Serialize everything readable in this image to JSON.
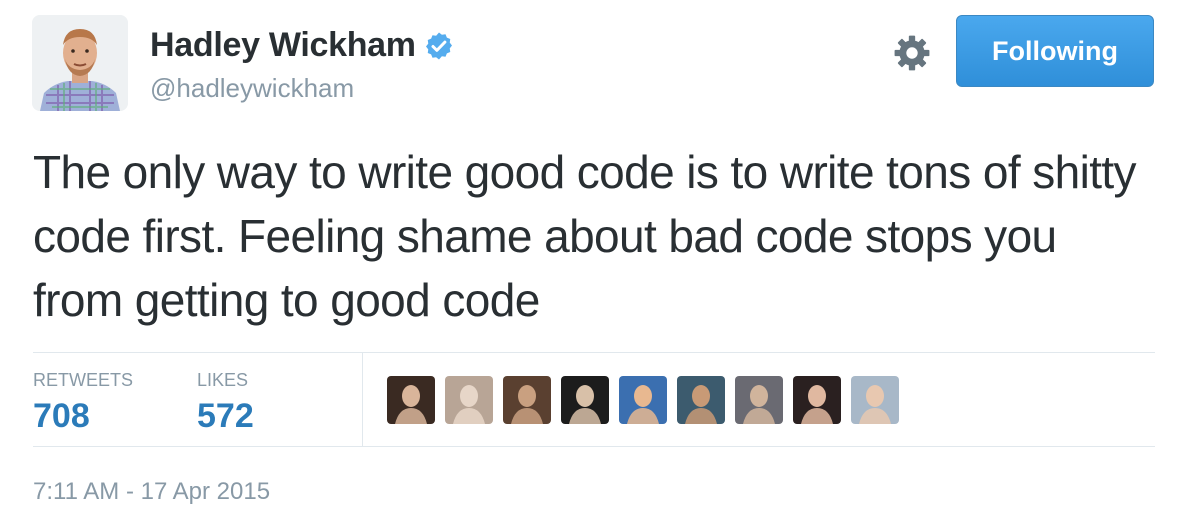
{
  "header": {
    "display_name": "Hadley Wickham",
    "handle": "@hadleywickham",
    "follow_button_label": "Following",
    "icons": {
      "verified": "verified-badge-icon",
      "settings": "gear-icon"
    },
    "colors": {
      "verified": "#55acee",
      "follow_button": "#3b9de8",
      "accent": "#2b7bb9"
    }
  },
  "tweet": {
    "text": "The only way to write good code is to write tons of shitty code first. Feeling shame about bad code stops you from getting to good code"
  },
  "stats": {
    "retweets_label": "RETWEETS",
    "retweets_value": "708",
    "likes_label": "LIKES",
    "likes_value": "572"
  },
  "likers": [
    {
      "colors": [
        "#3a2a22",
        "#d9b59a"
      ]
    },
    {
      "colors": [
        "#b8a596",
        "#e7d6c8"
      ]
    },
    {
      "colors": [
        "#5a4030",
        "#c9a080"
      ]
    },
    {
      "colors": [
        "#1c1c1c",
        "#d8c0a8"
      ]
    },
    {
      "colors": [
        "#3b6fb0",
        "#e8b890"
      ]
    },
    {
      "colors": [
        "#3c5b6e",
        "#c89a76"
      ]
    },
    {
      "colors": [
        "#6a6a72",
        "#d0b49c"
      ]
    },
    {
      "colors": [
        "#2a2020",
        "#e0b8a0"
      ]
    },
    {
      "colors": [
        "#a8b8c8",
        "#e8c8b0"
      ]
    }
  ],
  "footer": {
    "timestamp": "7:11 AM - 17 Apr 2015"
  }
}
